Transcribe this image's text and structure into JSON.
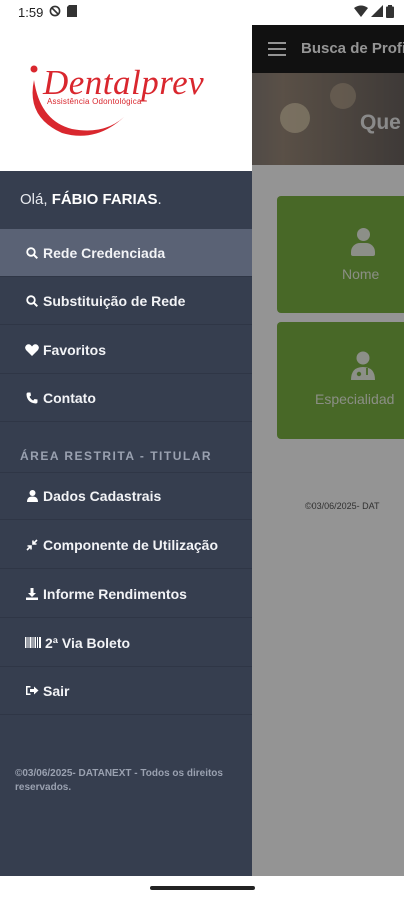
{
  "status_bar": {
    "time": "1:59"
  },
  "app": {
    "title": "Busca de Profi",
    "hero_text": "Que",
    "cards": [
      {
        "label": "Nome",
        "icon": "person-icon"
      },
      {
        "label": "Especialidad",
        "icon": "doctor-icon"
      }
    ],
    "footer": "©03/06/2025- DAT"
  },
  "drawer": {
    "logo": {
      "main": "Dentalprev",
      "sub": "Assistência Odontológica",
      "color": "#d9272e"
    },
    "greeting_prefix": "Olá, ",
    "greeting_name": "FÁBIO FARIAS",
    "greeting_suffix": ".",
    "items": [
      {
        "label": "Rede Credenciada",
        "icon": "search-icon",
        "active": true
      },
      {
        "label": "Substituição de Rede",
        "icon": "search-icon"
      },
      {
        "label": "Favoritos",
        "icon": "heart-icon"
      },
      {
        "label": "Contato",
        "icon": "phone-icon"
      }
    ],
    "section_title": "ÁREA RESTRITA - TITULAR",
    "restricted_items": [
      {
        "label": "Dados Cadastrais",
        "icon": "user-icon"
      },
      {
        "label": "Componente de Utilização",
        "icon": "compress-icon"
      },
      {
        "label": "Informe Rendimentos",
        "icon": "download-icon"
      },
      {
        "label": "2ª Via Boleto",
        "icon": "barcode-icon"
      },
      {
        "label": "Sair",
        "icon": "sign-out-icon"
      }
    ],
    "footer": "©03/06/2025- DATANEXT - Todos os direitos reservados."
  },
  "colors": {
    "drawer_bg": "#363e4f",
    "active_item": "#5a6275",
    "card_green": "#7cb344",
    "brand_red": "#d9272e"
  }
}
